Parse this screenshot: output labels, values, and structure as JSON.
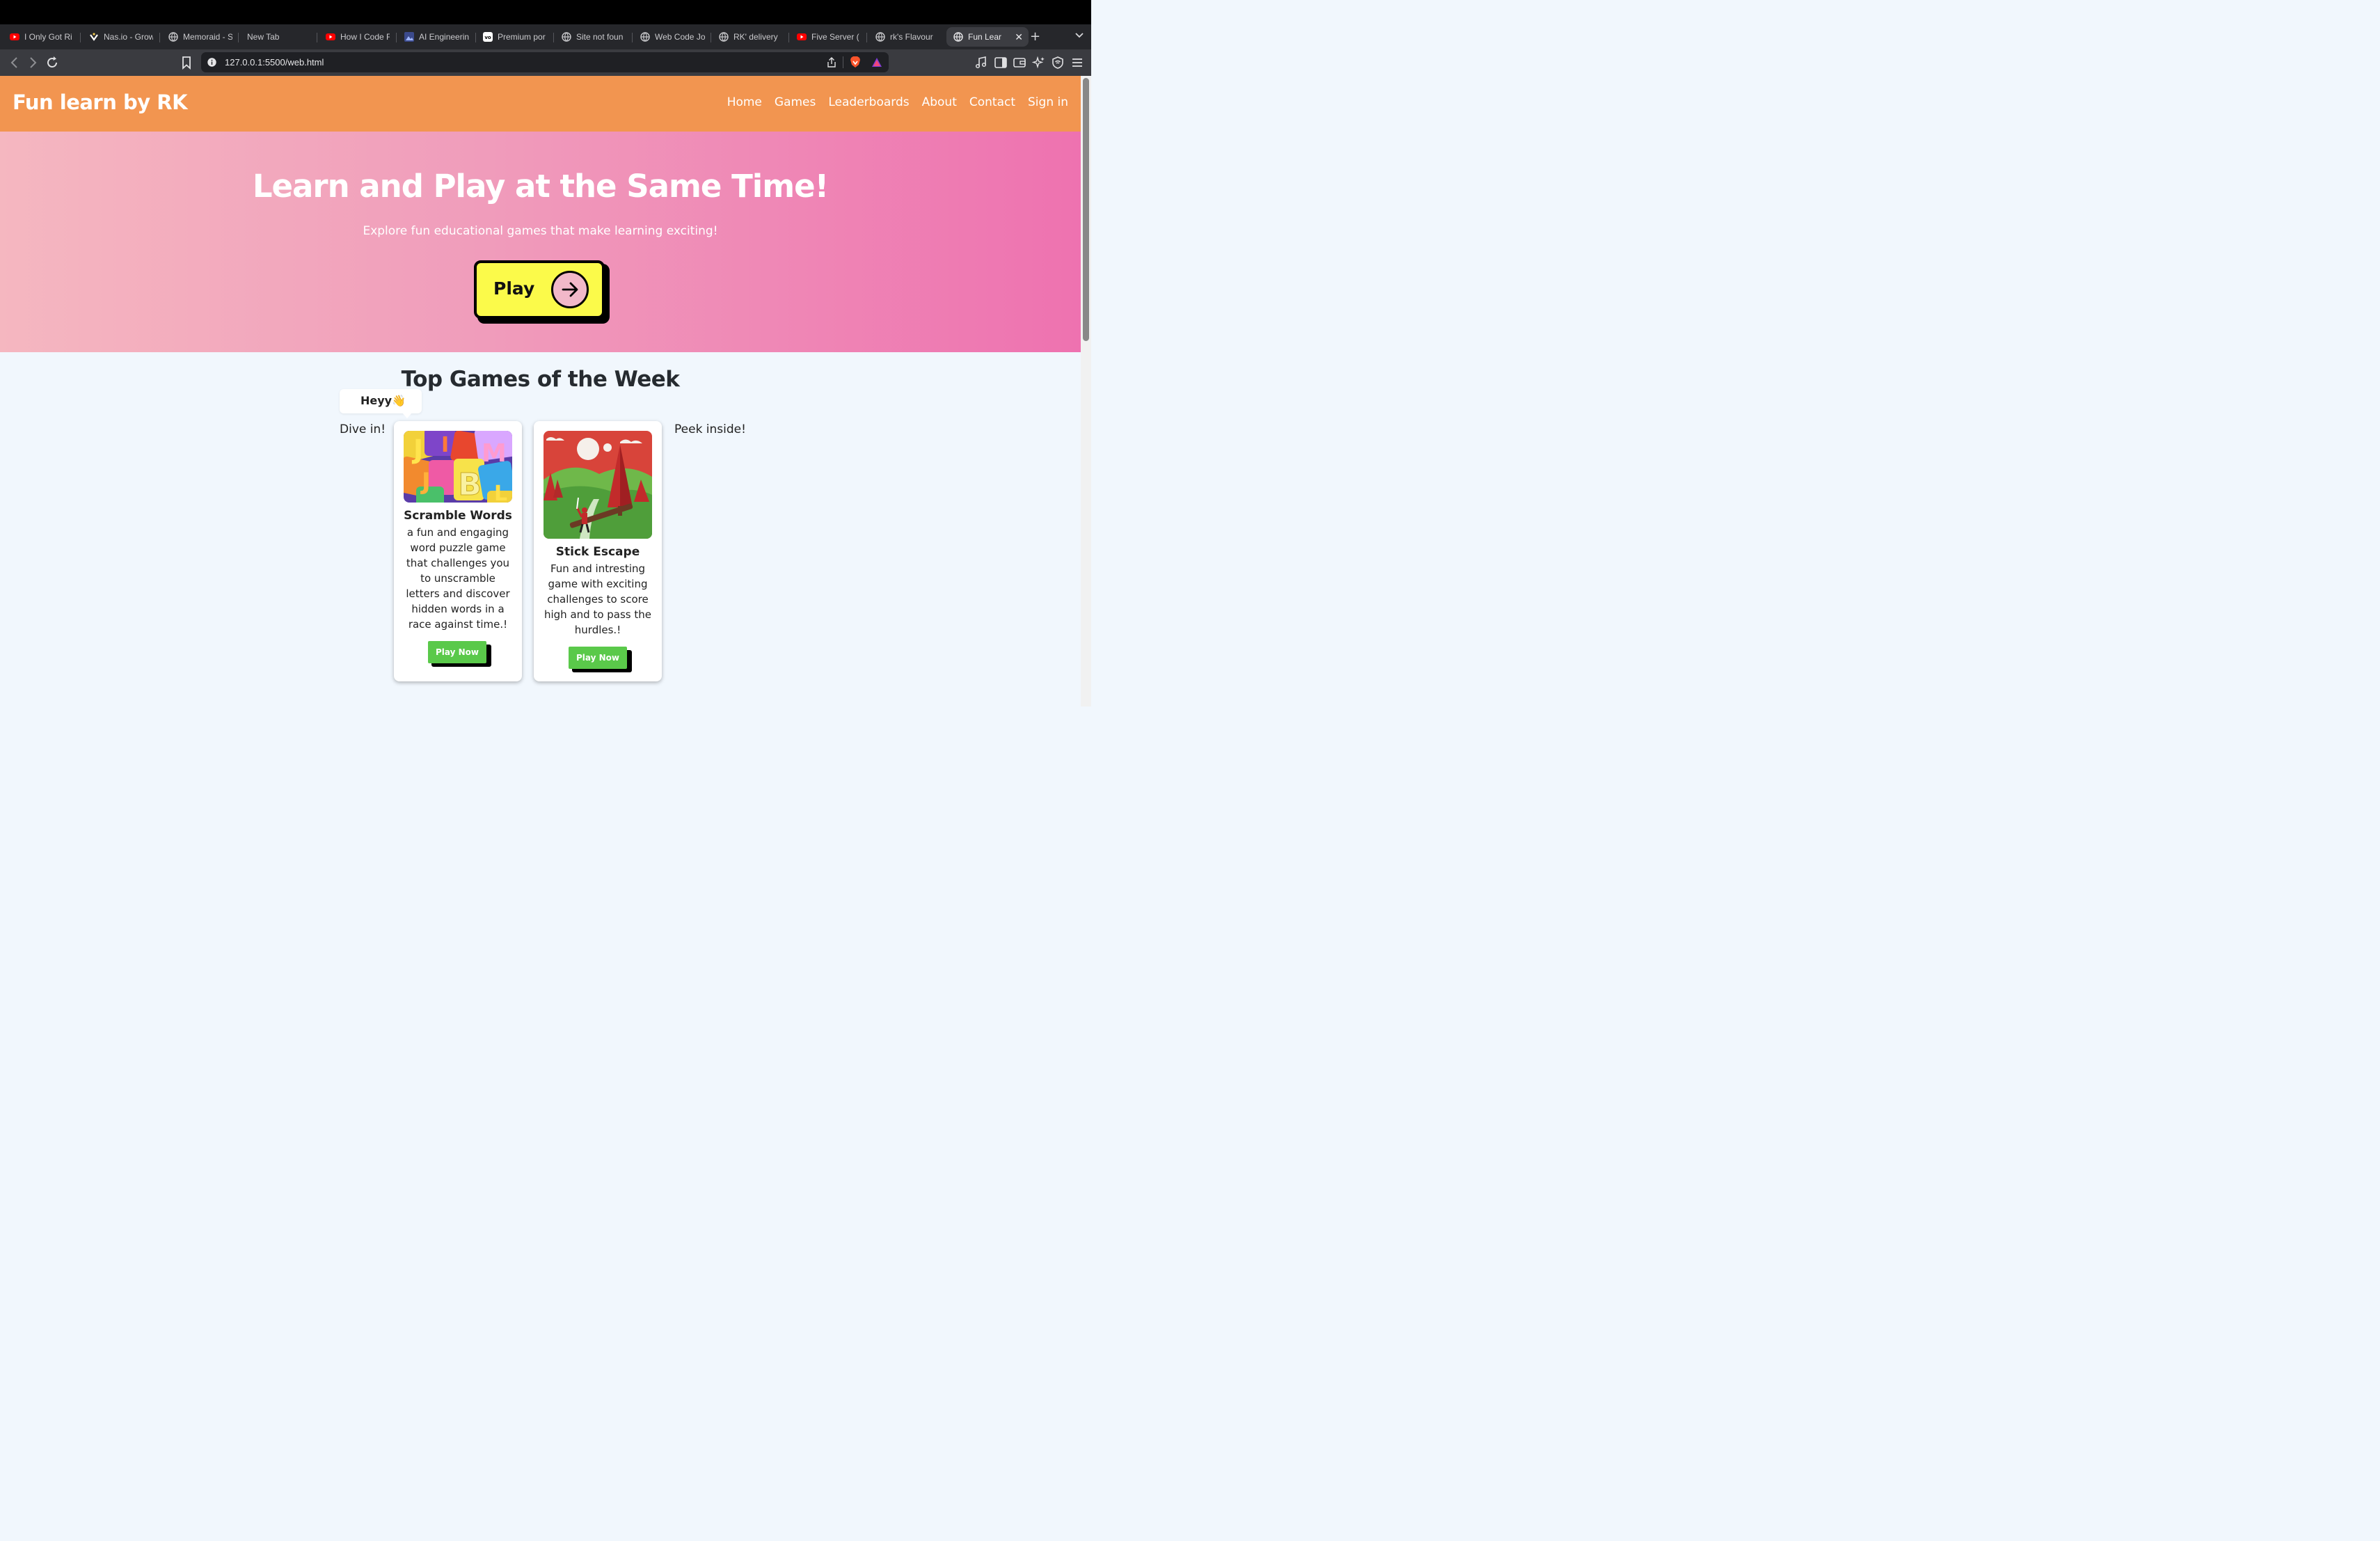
{
  "browser": {
    "tabs": [
      {
        "title": "I Only Got Ri",
        "icon": "youtube-icon"
      },
      {
        "title": "Nas.io - Grow",
        "icon": "nasio-icon"
      },
      {
        "title": "Memoraid - S",
        "icon": "globe-icon"
      },
      {
        "title": "New Tab",
        "icon": ""
      },
      {
        "title": "How I Code F",
        "icon": "youtube-icon"
      },
      {
        "title": "AI Engineerin",
        "icon": "image-icon"
      },
      {
        "title": "Premium por",
        "icon": "vo-icon"
      },
      {
        "title": "Site not foun",
        "icon": "globe-icon"
      },
      {
        "title": "Web Code Jo",
        "icon": "globe-icon"
      },
      {
        "title": "RK' delivery",
        "icon": "globe-icon"
      },
      {
        "title": "Five Server (",
        "icon": "youtube-icon"
      },
      {
        "title": "rk's Flavour",
        "icon": "globe-icon"
      },
      {
        "title": "Fun Lear",
        "icon": "globe-icon",
        "active": true
      }
    ],
    "new_tab": "+",
    "url": "127.0.0.1:5500/web.html",
    "colors": {
      "youtube": "#ff0000",
      "brave": "#fb542b"
    }
  },
  "nav": {
    "brand": "Fun learn by RK",
    "links": [
      "Home",
      "Games",
      "Leaderboards",
      "About",
      "Contact",
      "Sign in"
    ],
    "color": "#f29550"
  },
  "hero": {
    "title": "Learn and Play at the Same Time!",
    "subtitle": "Explore fun educational games that make learning exciting!",
    "play_label": "Play",
    "play_color": "#fbfa4a"
  },
  "games": {
    "section_title": "Top Games of the Week",
    "bubble": "Heyy👋",
    "left_text": "Dive in!",
    "right_text": "Peek inside!",
    "cards": [
      {
        "title": "Scramble Words",
        "description": "a fun and engaging word puzzle game that challenges you to unscramble letters and discover hidden words in a race against time.!",
        "button": "Play Now",
        "image_icon": "alphabet-letters-image"
      },
      {
        "title": "Stick Escape",
        "description": "Fun and intresting game with exciting challenges to score high and to pass the hurdles.!",
        "button": "Play Now",
        "image_icon": "forest-landscape-image"
      }
    ],
    "button_color": "#5ac94a"
  }
}
